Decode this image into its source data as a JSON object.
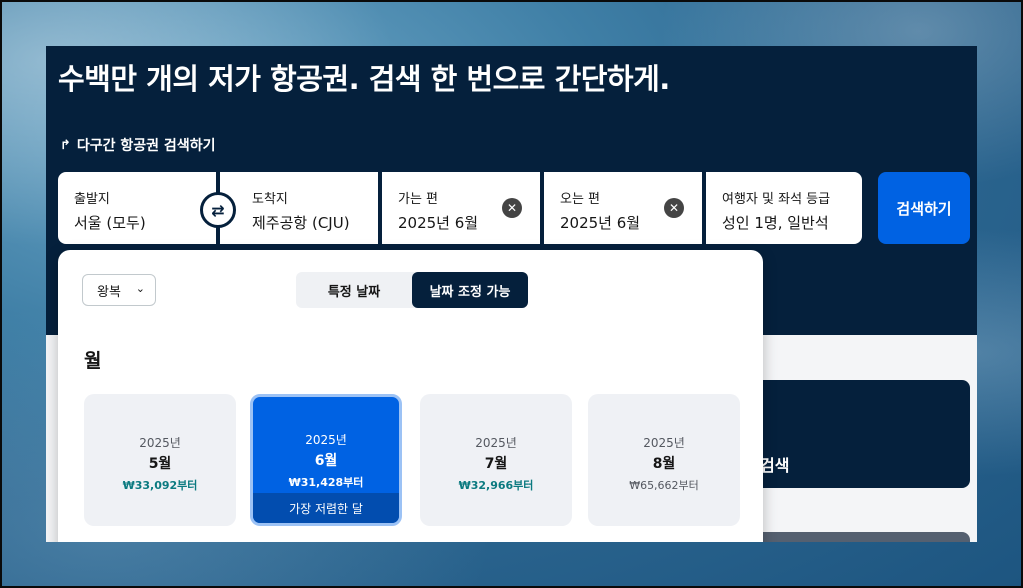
{
  "hero": {
    "headline": "수백만 개의 저가 항공권. 검색 한 번으로 간단하게.",
    "multicity_label": "다구간 항공권 검색하기"
  },
  "search": {
    "origin": {
      "label": "출발지",
      "value": "서울 (모두)"
    },
    "destination": {
      "label": "도착지",
      "value": "제주공항 (CJU)"
    },
    "depart": {
      "label": "가는 편",
      "value": "2025년 6월"
    },
    "return": {
      "label": "오는 편",
      "value": "2025년 6월"
    },
    "travellers": {
      "label": "여행자 및 좌석 등급",
      "value": "성인 1명, 일반석"
    },
    "button": "검색하기"
  },
  "popup": {
    "trip_type": "왕복",
    "toggle": [
      "특정 날짜",
      "날짜 조정 가능"
    ],
    "section_title": "월",
    "months": [
      {
        "year": "2025년",
        "month": "5월",
        "price": "₩33,092부터",
        "selected": false
      },
      {
        "year": "2025년",
        "month": "6월",
        "price": "₩31,428부터",
        "selected": true,
        "badge": "가장 저렴한 달"
      },
      {
        "year": "2025년",
        "month": "7월",
        "price": "₩32,966부터",
        "selected": false
      },
      {
        "year": "2025년",
        "month": "8월",
        "price": "₩65,662부터",
        "selected": false
      }
    ]
  },
  "side_card_text": "검색",
  "colors": {
    "navy": "#05203c",
    "accent": "#0062e3",
    "price_teal": "#0b7a80"
  }
}
